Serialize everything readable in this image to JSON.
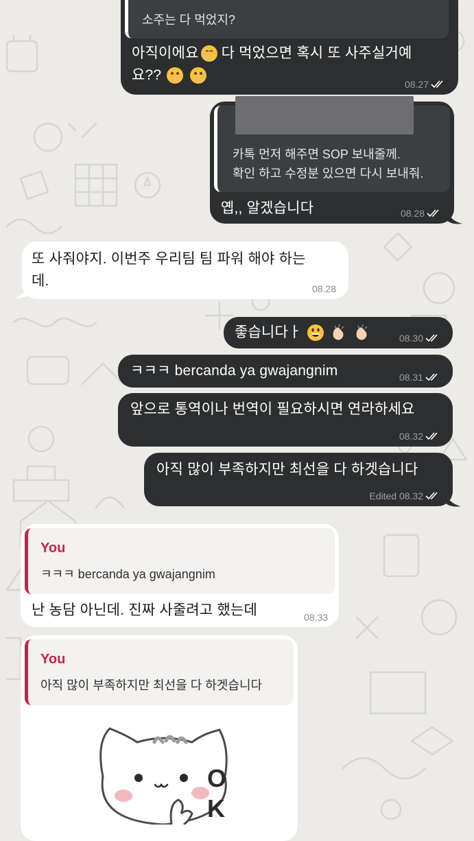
{
  "colors": {
    "outgoing_bubble": "#2c2e2f",
    "incoming_bubble": "#ffffff",
    "quote_accent": "#c91d55",
    "background": "#ecebe8"
  },
  "messages": [
    {
      "id": "m1",
      "quote_text": "소주는 다 먹었지?",
      "text_line1": "아직이에요",
      "text_line1b": "다 먹었으면 혹시 또 사주실거예",
      "text_line2": "요??",
      "time": "08.27"
    },
    {
      "id": "m2",
      "quote_line1": "카톡 먼저 해주면 SOP 보내줄께.",
      "quote_line2": "확인 하고 수정분 있으면 다시 보내줘.",
      "text": "옙,, 알겠습니다",
      "time": "08.28"
    },
    {
      "id": "m3",
      "text_line1": "또 사줘야지.  이번주 우리팀 팀 파워 해야 하는",
      "text_line2": "데.",
      "time": "08.28"
    },
    {
      "id": "m4",
      "text": "좋습니다ㅏ",
      "time": "08.30"
    },
    {
      "id": "m5",
      "text": "ㅋㅋㅋ bercanda ya gwajangnim",
      "time": "08.31"
    },
    {
      "id": "m6",
      "text": "앞으로 통역이나 번역이 필요하시면 연라하세요",
      "time": "08.32"
    },
    {
      "id": "m7",
      "text": "아직 많이 부족하지만 최선을 다 하겟습니다",
      "time": "Edited 08.32"
    },
    {
      "id": "m8",
      "quote_author": "You",
      "quote_text": "ㅋㅋㅋ bercanda ya gwajangnim",
      "text": "난 농담 아닌데.  진짜 사줄려고 했는데",
      "time": "08.33"
    },
    {
      "id": "m9",
      "quote_author": "You",
      "quote_text": "아직 많이 부족하지만 최선을 다 하겟습니다",
      "sticker_text_1": "O",
      "sticker_text_2": "K"
    }
  ]
}
